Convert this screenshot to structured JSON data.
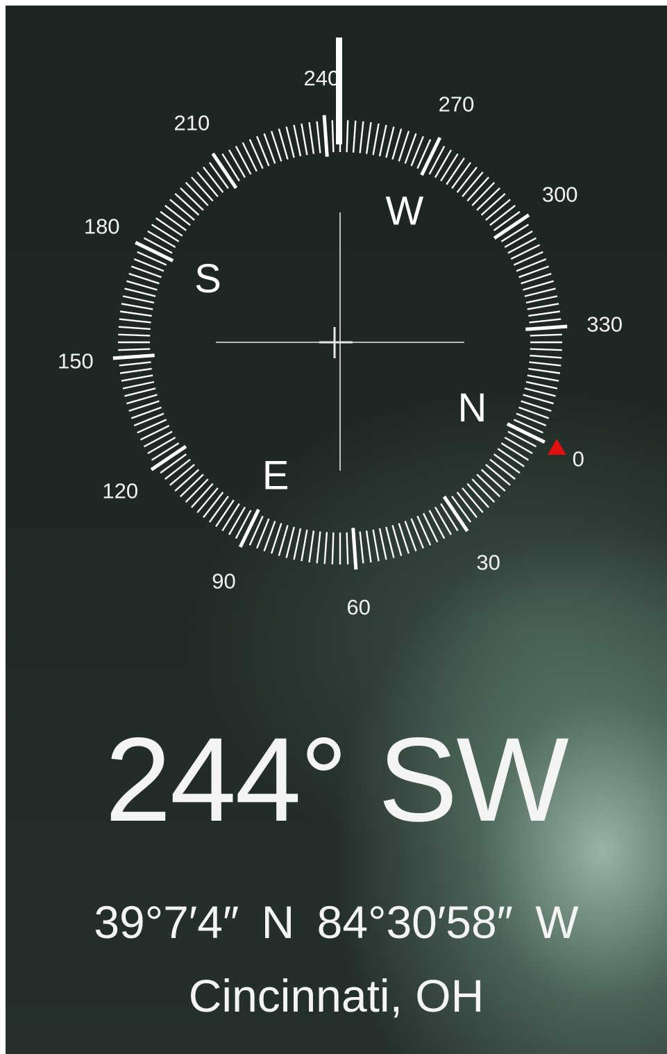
{
  "compass": {
    "heading_degrees": 244,
    "degree_labels": [
      "0",
      "30",
      "60",
      "90",
      "120",
      "150",
      "180",
      "210",
      "240",
      "270",
      "300",
      "330"
    ],
    "cardinals": [
      "N",
      "E",
      "S",
      "W"
    ],
    "north_marker_color": "#e01010",
    "tick_color": "#ffffff"
  },
  "heading": {
    "degrees_text": "244°",
    "direction": "SW"
  },
  "location": {
    "latitude": "39°7′4″ N",
    "longitude": "84°30′58″ W",
    "city": "Cincinnati, OH"
  }
}
